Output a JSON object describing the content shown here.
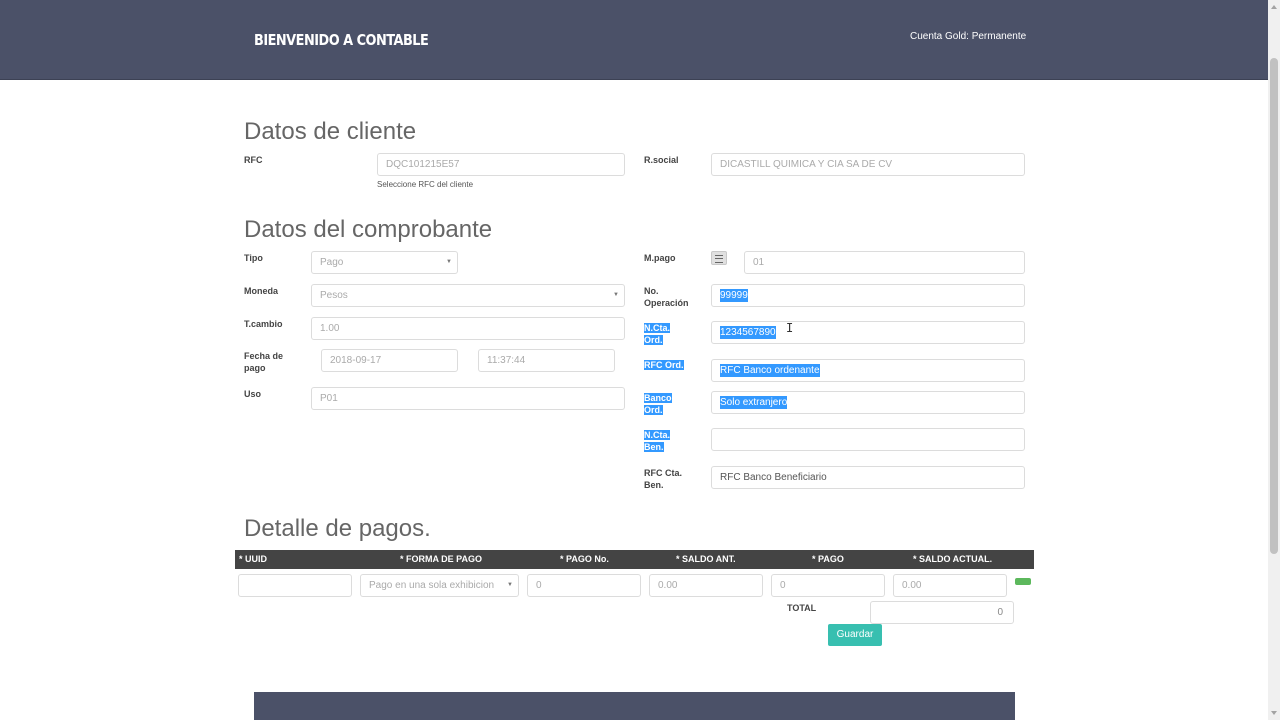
{
  "header": {
    "brand": "BIENVENIDO A CONTABLE",
    "account": "Cuenta Gold: Permanente"
  },
  "cliente": {
    "title": "Datos de cliente",
    "rfc_label": "RFC",
    "rfc_value": "DQC101215E57",
    "rfc_hint": "Seleccione RFC del cliente",
    "rsocial_label": "R.social",
    "rsocial_value": "DICASTILL QUIMICA Y CIA SA DE CV"
  },
  "comprobante": {
    "title": "Datos del comprobante",
    "tipo_label": "Tipo",
    "tipo_value": "Pago",
    "moneda_label": "Moneda",
    "moneda_value": "Pesos",
    "tcambio_label": "T.cambio",
    "tcambio_value": "1.00",
    "fecha_label_1": "Fecha de",
    "fecha_label_2": "pago",
    "fecha_value": "2018-09-17",
    "hora_value": "11:37:44",
    "uso_label": "Uso",
    "uso_value": "P01",
    "mpago_label": "M.pago",
    "mpago_value": "01",
    "noop_label_1": "No.",
    "noop_label_2": "Operación",
    "noop_value": "99999",
    "nctaord_label_1": "N.Cta.",
    "nctaord_label_2": "Ord.",
    "nctaord_value": "1234567890",
    "rfcord_label": "RFC Ord.",
    "rfcord_value": "RFC Banco ordenante",
    "bancoord_label_1": "Banco",
    "bancoord_label_2": "Ord.",
    "bancoord_value": "Solo extranjero",
    "nctaben_label_1": "N.Cta.",
    "nctaben_label_2": "Ben.",
    "nctaben_value": "",
    "rfcben_label_1": "RFC Cta.",
    "rfcben_label_2": "Ben.",
    "rfcben_placeholder": "RFC Banco Beneficiario"
  },
  "pagos": {
    "title": "Detalle de pagos.",
    "columns": [
      "* UUID",
      "* FORMA DE PAGO",
      "* PAGO No.",
      "* SALDO ANT.",
      "* PAGO",
      "* SALDO ACTUAL."
    ],
    "row": {
      "uuid": "",
      "forma": "Pago en una sola exhibicion",
      "pago_no": "0",
      "saldo_ant": "0.00",
      "pago": "0",
      "saldo_actual": "0.00"
    },
    "total_label": "TOTAL",
    "total_value": "0",
    "save_label": "Guardar"
  },
  "colors": {
    "header_bg": "#4b5168",
    "selection": "#3399ff",
    "accent": "#38bfb0",
    "add": "#5cb85c",
    "table_head": "#444444"
  },
  "icons": {
    "mpago": "list-icon",
    "add_row": "add-row-icon"
  }
}
